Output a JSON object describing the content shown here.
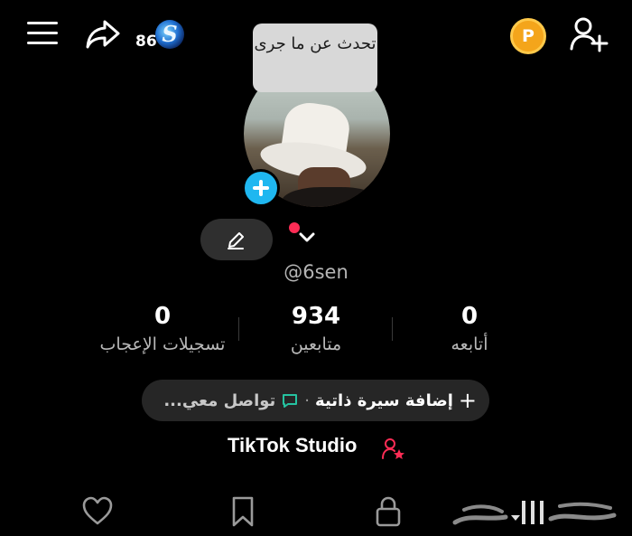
{
  "header": {
    "badge_number": "86",
    "badge_logo_letter": "S",
    "coin_letter": "P"
  },
  "profile": {
    "tooltip_text": "تحدث عن ما جرى",
    "username": "@6sen"
  },
  "stats": [
    {
      "value": "0",
      "label": "تسجيلات الإعجاب"
    },
    {
      "value": "934",
      "label": "متابعين"
    },
    {
      "value": "0",
      "label": "أتابعه"
    }
  ],
  "bio": {
    "add_bio_label": "إضافة سيرة ذاتية",
    "separator": "·",
    "contact_label": "تواصل معي..."
  },
  "studio": {
    "label": "TikTok Studio"
  },
  "colors": {
    "accent_blue": "#1fb7f0",
    "red_dot": "#fe2c55",
    "coin": "#f4a51b",
    "chat_green": "#25c2a0"
  }
}
